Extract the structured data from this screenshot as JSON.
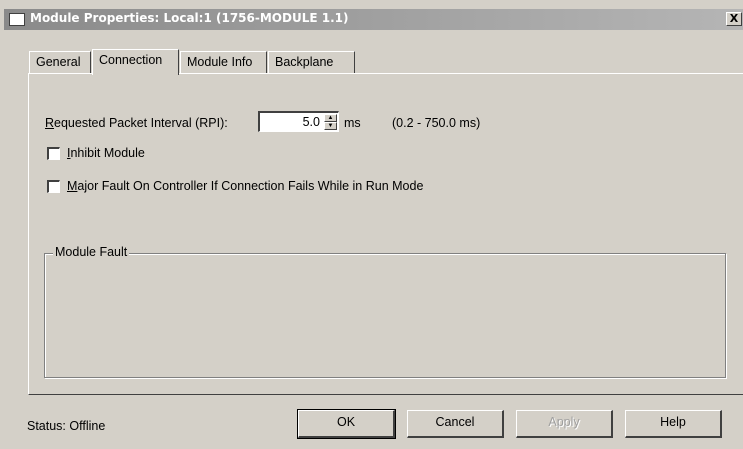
{
  "window": {
    "title": "Module Properties: Local:1 (1756-MODULE 1.1)",
    "close_glyph": "X"
  },
  "tabs": [
    {
      "label": "General",
      "active": false
    },
    {
      "label": "Connection",
      "active": true
    },
    {
      "label": "Module Info",
      "active": false
    },
    {
      "label": "Backplane",
      "active": false
    }
  ],
  "connection": {
    "rpi_label_mnemonic": "R",
    "rpi_label_rest": "equested Packet Interval (RPI):",
    "rpi_value": "5.0",
    "rpi_unit": "ms",
    "rpi_range": "(0.2 - 750.0 ms)",
    "inhibit_mnemonic": "I",
    "inhibit_rest": "nhibit Module",
    "inhibit_checked": false,
    "major_fault_mnemonic": "M",
    "major_fault_rest": "ajor Fault On Controller If Connection Fails While in Run Mode",
    "major_fault_checked": false,
    "module_fault_title": "Module Fault"
  },
  "status": {
    "text": "Status:  Offline"
  },
  "buttons": {
    "ok": "OK",
    "cancel": "Cancel",
    "apply": "Apply",
    "help": "Help"
  },
  "colors": {
    "dialog_bg": "#d4d0c8",
    "titlebar_inactive": "#8a8a8a"
  }
}
